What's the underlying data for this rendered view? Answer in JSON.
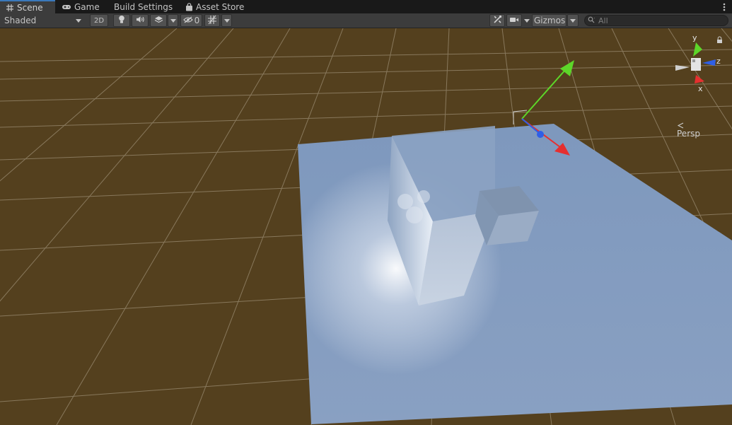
{
  "tabs": [
    {
      "label": "Scene",
      "icon": "grid-icon",
      "active": true
    },
    {
      "label": "Game",
      "icon": "gamepad-icon",
      "active": false
    },
    {
      "label": "Build Settings",
      "icon": "",
      "active": false
    },
    {
      "label": "Asset Store",
      "icon": "shopping-bag-icon",
      "active": false
    }
  ],
  "toolbar": {
    "draw_mode": "Shaded",
    "mode_2d": "2D",
    "hidden_count": "0",
    "gizmos_label": "Gizmos",
    "search_placeholder": "All",
    "icons": [
      "light-bulb-icon",
      "audio-icon",
      "layers-icon",
      "visibility-icon",
      "grid-snap-icon",
      "tools-icon",
      "camera-icon",
      "search-icon"
    ]
  },
  "scene_gizmo": {
    "axes": {
      "y": "y",
      "z": "z",
      "x": "x"
    },
    "projection_label": "Persp",
    "lock_icon": "lock-icon"
  },
  "colors": {
    "ground": "#54401e",
    "grid_line": "#9a8b71",
    "plane": "#7d95b8",
    "axis_x": "#e62f2f",
    "axis_y": "#5dd629",
    "axis_z": "#2f5fe6",
    "toolbar_bg": "#3c3c3c",
    "tab_active_accent": "#3a79bb"
  }
}
